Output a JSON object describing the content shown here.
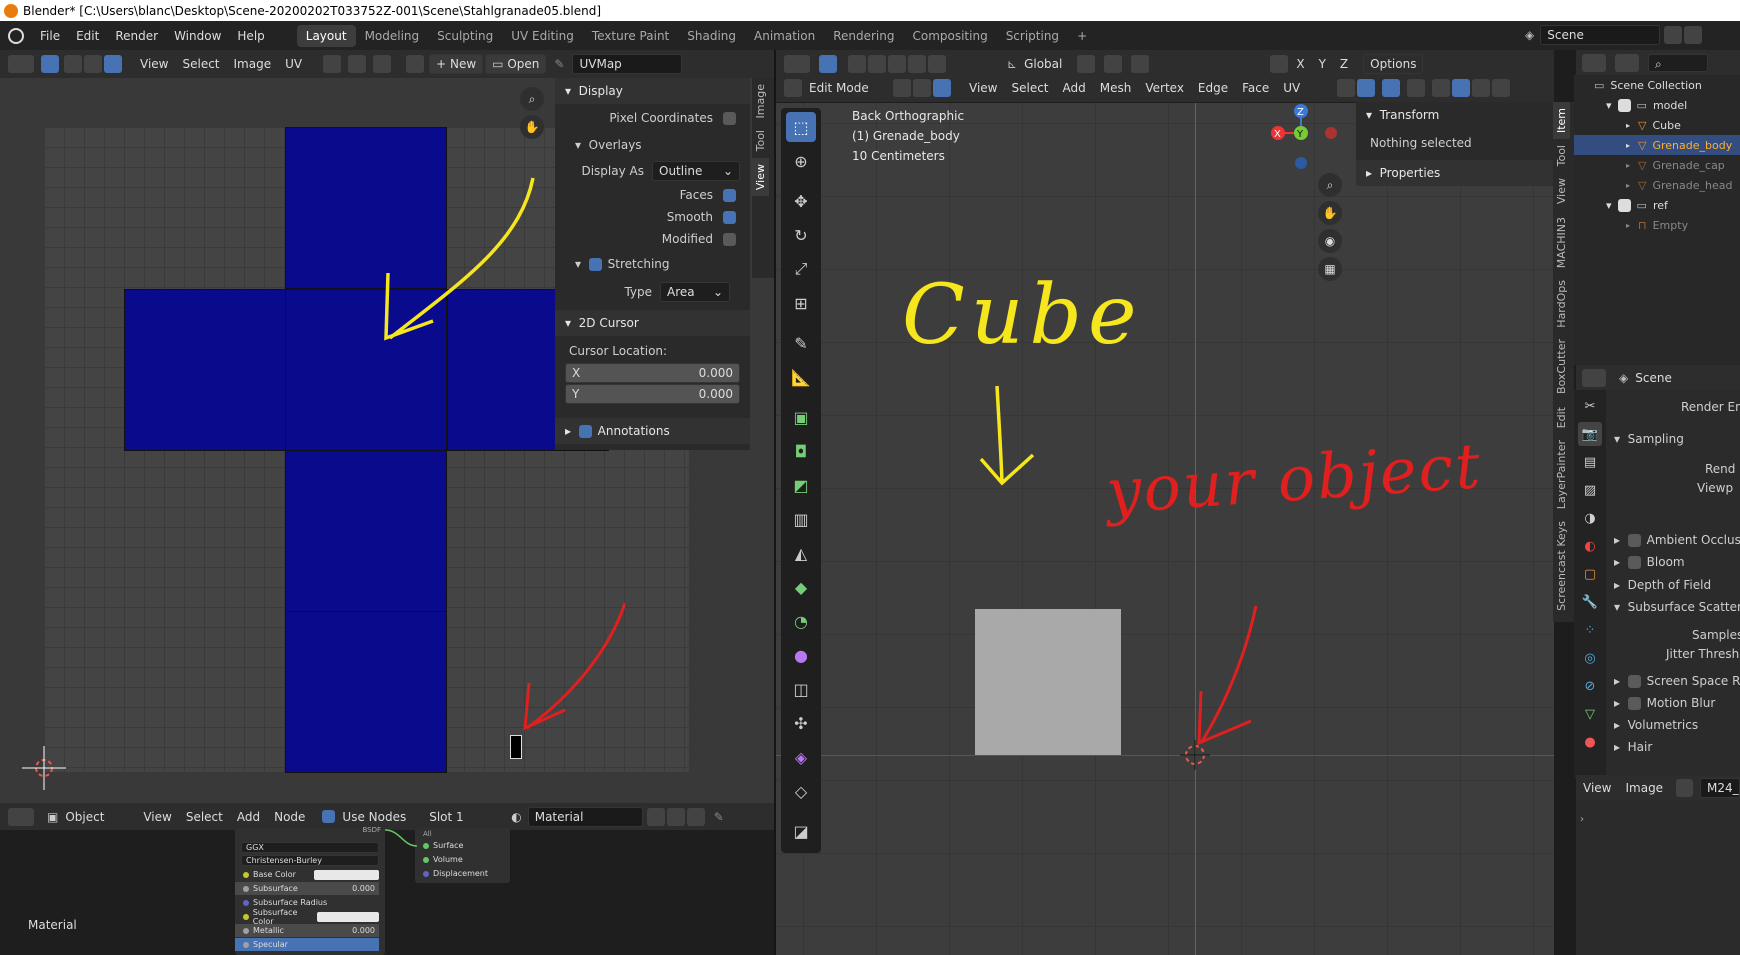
{
  "window_title": "Blender* [C:\\Users\\blanc\\Desktop\\Scene-20200202T033752Z-001\\Scene\\Stahlgranade05.blend]",
  "menu": [
    "File",
    "Edit",
    "Render",
    "Window",
    "Help"
  ],
  "workspaces": [
    "Layout",
    "Modeling",
    "Sculpting",
    "UV Editing",
    "Texture Paint",
    "Shading",
    "Animation",
    "Rendering",
    "Compositing",
    "Scripting"
  ],
  "scene_name": "Scene",
  "uv_editor": {
    "header_menus": [
      "View",
      "Select",
      "Image",
      "UV"
    ],
    "new_label": "New",
    "open_label": "Open",
    "uvmap": "UVMap",
    "tabs": [
      "Image",
      "Tool",
      "View"
    ],
    "display_panel": "Display",
    "pixel_coordinates": "Pixel Coordinates",
    "overlays": "Overlays",
    "display_as_label": "Display As",
    "display_as_value": "Outline",
    "faces": "Faces",
    "smooth": "Smooth",
    "modified": "Modified",
    "stretching": "Stretching",
    "type_label": "Type",
    "type_value": "Area",
    "cursor_panel": "2D Cursor",
    "cursor_location": "Cursor Location:",
    "x_label": "X",
    "x_value": "0.000",
    "y_label": "Y",
    "y_value": "0.000",
    "annotations": "Annotations"
  },
  "viewport": {
    "header_menus": [
      "View",
      "Select",
      "Add",
      "Mesh",
      "Vertex",
      "Edge",
      "Face",
      "UV"
    ],
    "mode": "Edit Mode",
    "orientation": "Global",
    "options": "Options",
    "info_line1": "Back Orthographic",
    "info_line2": "(1) Grenade_body",
    "info_line3": "10 Centimeters",
    "transform_panel": "Transform",
    "nothing_selected": "Nothing selected",
    "properties_panel": "Properties",
    "side_tabs": [
      "Item",
      "Tool",
      "View",
      "MACHIN3",
      "HardOps",
      "BoxCutter",
      "Edit",
      "LayerPainter",
      "Screencast Keys"
    ],
    "annotation_cube": "Cube",
    "annotation_object": "your object"
  },
  "outliner": {
    "title": "Scene Collection",
    "items": [
      {
        "label": "model",
        "depth": 1
      },
      {
        "label": "Cube",
        "depth": 2
      },
      {
        "label": "Grenade_body",
        "depth": 2
      },
      {
        "label": "Grenade_cap",
        "depth": 2
      },
      {
        "label": "Grenade_head",
        "depth": 2
      },
      {
        "label": "ref",
        "depth": 1
      },
      {
        "label": "Empty",
        "depth": 2
      }
    ]
  },
  "properties": {
    "scene_label": "Scene",
    "render_engine": "Render Engi",
    "sampling": "Sampling",
    "render": "Rend",
    "viewport": "Viewp",
    "panels": [
      "Ambient Occlusic",
      "Bloom",
      "Depth of Field",
      "Subsurface Scatterin"
    ],
    "samples": "Samples",
    "jitter": "Jitter Threshold",
    "panels2": [
      "Screen Space Re",
      "Motion Blur",
      "Volumetrics",
      "Hair"
    ],
    "bottom_view": "View",
    "bottom_image": "Image",
    "bottom_field": "M24_"
  },
  "node_editor": {
    "object_label": "Object",
    "menus": [
      "View",
      "Select",
      "Add",
      "Node"
    ],
    "use_nodes": "Use Nodes",
    "slot": "Slot 1",
    "material": "Material",
    "footer_label": "Material",
    "bsdf_rows": [
      "GGX",
      "Christensen-Burley",
      "Base Color",
      "Subsurface",
      "Subsurface Radius",
      "Subsurface Color",
      "Metallic",
      "Specular"
    ],
    "subsurface_value": "0.000",
    "metallic_value": "0.000",
    "output_rows": [
      "All",
      "Surface",
      "Volume",
      "Displacement"
    ],
    "bsdf_label": "BSDF"
  },
  "colors": {
    "uv_face": "#0a0a8c",
    "annotation_yellow": "#f5e61e",
    "annotation_red": "#e01f1f",
    "accent": "#4772b3"
  }
}
